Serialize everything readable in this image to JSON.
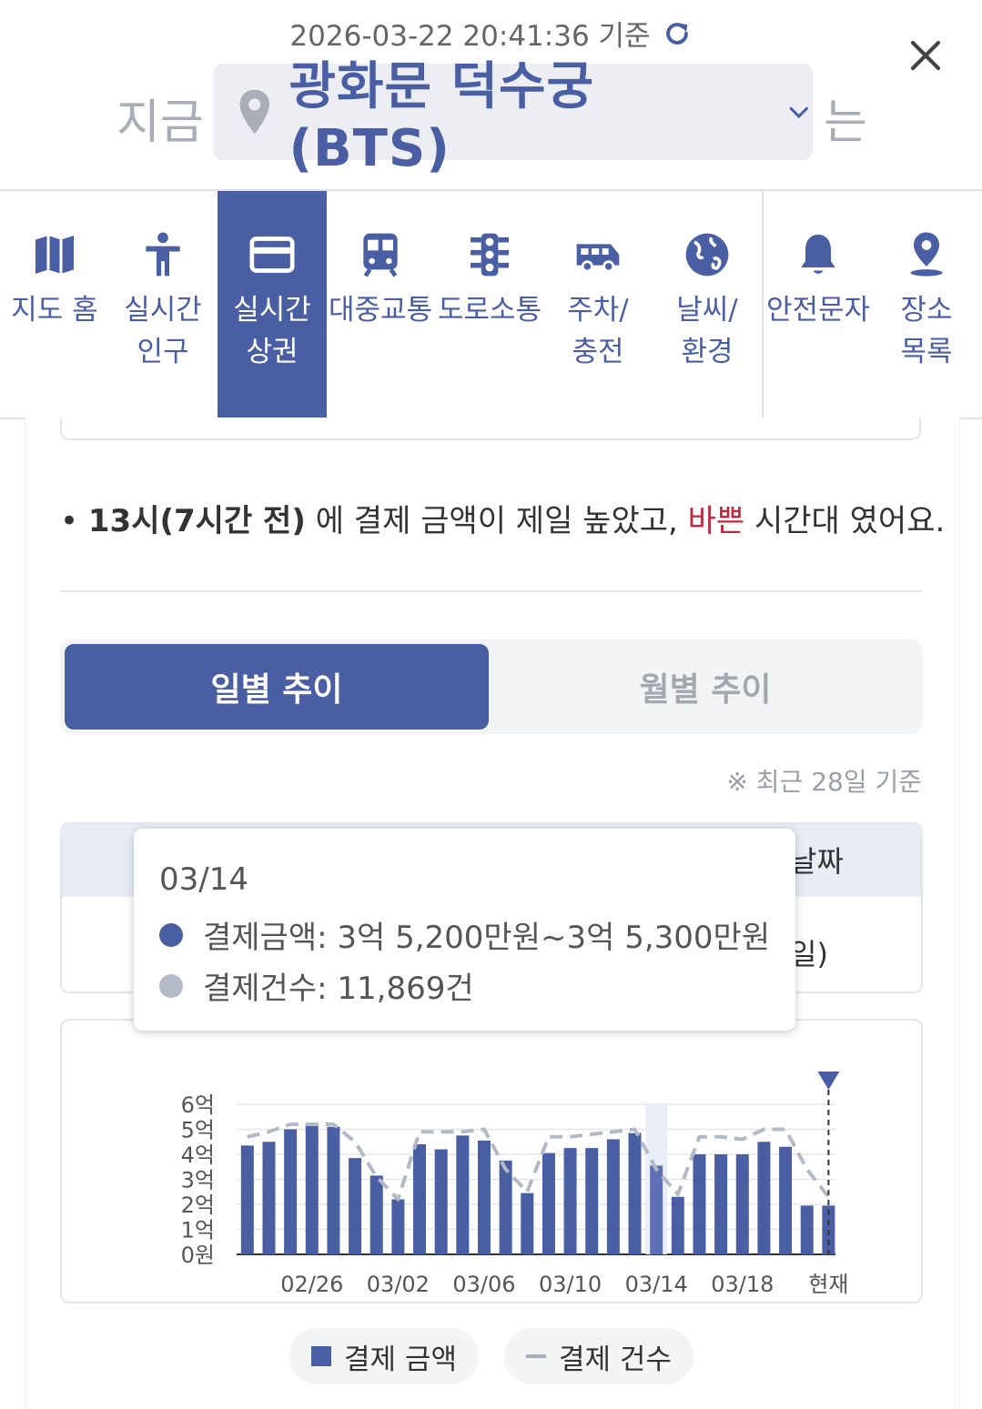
{
  "header": {
    "timestamp": "2026-03-22 20:41:36 기준",
    "prefix": "지금",
    "place": "광화문 덕수궁 (BTS)",
    "suffix": "는"
  },
  "nav": [
    {
      "label": "지도 홈",
      "icon": "map-icon"
    },
    {
      "label": "실시간\n인구",
      "icon": "person-icon"
    },
    {
      "label": "실시간\n상권",
      "icon": "card-icon",
      "active": true
    },
    {
      "label": "대중교통",
      "icon": "train-icon"
    },
    {
      "label": "도로소통",
      "icon": "traffic-light-icon"
    },
    {
      "label": "주차/\n충전",
      "icon": "van-icon"
    },
    {
      "label": "날씨/\n환경",
      "icon": "globe-icon"
    },
    {
      "label": "안전문자",
      "icon": "bell-icon"
    },
    {
      "label": "장소\n목록",
      "icon": "location-list-icon"
    }
  ],
  "summary": {
    "bullet": "•",
    "highlight": "13시(7시간 전)",
    "middle": " 에 결제 금액이 제일 높았고, ",
    "busy": "바쁜",
    "end": " 시간대 였어요."
  },
  "tabs": {
    "daily": "일별 추이",
    "monthly": "월별 추이"
  },
  "basis_note": "※ 최근 28일 기준",
  "table": {
    "header_right": "날짜",
    "cell_right": "일)"
  },
  "tooltip": {
    "date": "03/14",
    "amount": "결제금액: 3억 5,200만원~3억 5,300만원",
    "count": "결제건수: 11,869건"
  },
  "legend": {
    "amount": "결제 금액",
    "count": "결제 건수"
  },
  "colors": {
    "accent": "#4a5ea4",
    "count_line": "#a8aec0",
    "busy": "#c0283c"
  },
  "chart_data": {
    "type": "bar",
    "y_ticks": [
      "6억",
      "5억",
      "4억",
      "3억",
      "2억",
      "1억",
      "0원"
    ],
    "x_ticks": [
      "02/26",
      "03/02",
      "03/06",
      "03/10",
      "03/14",
      "03/18",
      "현재"
    ],
    "ylim": [
      0,
      6
    ],
    "yunit": "억",
    "series": [
      {
        "name": "결제 금액",
        "values": [
          4.35,
          4.5,
          5.0,
          5.2,
          5.1,
          3.85,
          3.15,
          2.2,
          4.4,
          4.2,
          4.75,
          4.55,
          3.75,
          2.45,
          4.05,
          4.25,
          4.25,
          4.6,
          4.85,
          3.55,
          2.3,
          4.0,
          4.0,
          4.0,
          4.5,
          4.3,
          1.95,
          1.95
        ]
      },
      {
        "name": "결제 건수",
        "values": [
          4.7,
          4.9,
          5.2,
          5.2,
          5.2,
          4.5,
          3.1,
          2.2,
          4.9,
          4.9,
          4.9,
          5.0,
          3.4,
          2.5,
          4.7,
          4.7,
          4.8,
          4.9,
          5.0,
          3.4,
          2.4,
          4.7,
          4.7,
          4.6,
          5.0,
          5.0,
          3.4,
          2.3
        ]
      }
    ],
    "highlight_index": 19,
    "current_marker": "현재"
  }
}
